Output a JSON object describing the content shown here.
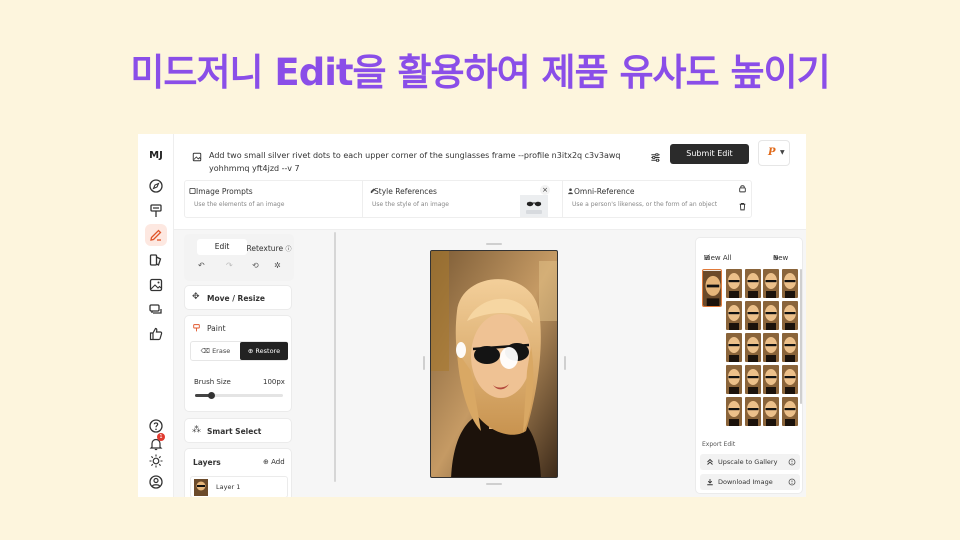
{
  "headline": "미드저니 Edit을 활용하여 제품 유사도 높이기",
  "rail": {
    "logo": "MJ",
    "icons": [
      "compass-icon",
      "brush-icon",
      "edit-icon",
      "layers-icon",
      "image-icon",
      "chat-icon",
      "thumbs-up-icon"
    ],
    "bottom_icons": [
      "help-icon",
      "bell-icon",
      "sun-icon",
      "user-icon"
    ],
    "notification_count": "1"
  },
  "prompt": {
    "text": "Add two small silver rivet dots to each upper corner of the sunglasses frame --profile n3itx2q c3v3awq yohhmmq yft4jzd --v 7",
    "submit_label": "Submit Edit",
    "profile_letter": "P"
  },
  "refs": {
    "image_prompts": {
      "title": "Image Prompts",
      "sub": "Use the elements of an image"
    },
    "style_references": {
      "title": "Style References",
      "sub": "Use the style of an image"
    },
    "omni_reference": {
      "title": "Omni-Reference",
      "sub": "Use a person's likeness, or the form of an object"
    },
    "close_glyph": "×"
  },
  "editor": {
    "tab_edit": "Edit",
    "tab_retexture": "Retexture",
    "move_resize": "Move / Resize",
    "paint": "Paint",
    "erase": "Erase",
    "restore": "Restore",
    "brush_size_label": "Brush Size",
    "brush_size_value": "100px",
    "brush_size_fraction": 0.18,
    "smart_select": "Smart Select",
    "layers_label": "Layers",
    "add_label": "Add",
    "layer_1": "Layer 1"
  },
  "gallery": {
    "view_all": "View All",
    "new": "New",
    "export_label": "Export Edit",
    "upscale": "Upscale to Gallery",
    "download": "Download Image"
  },
  "colors": {
    "headline": "#8a4ee8",
    "accent": "#e06a1a",
    "submit_bg": "#2b2b2b"
  }
}
